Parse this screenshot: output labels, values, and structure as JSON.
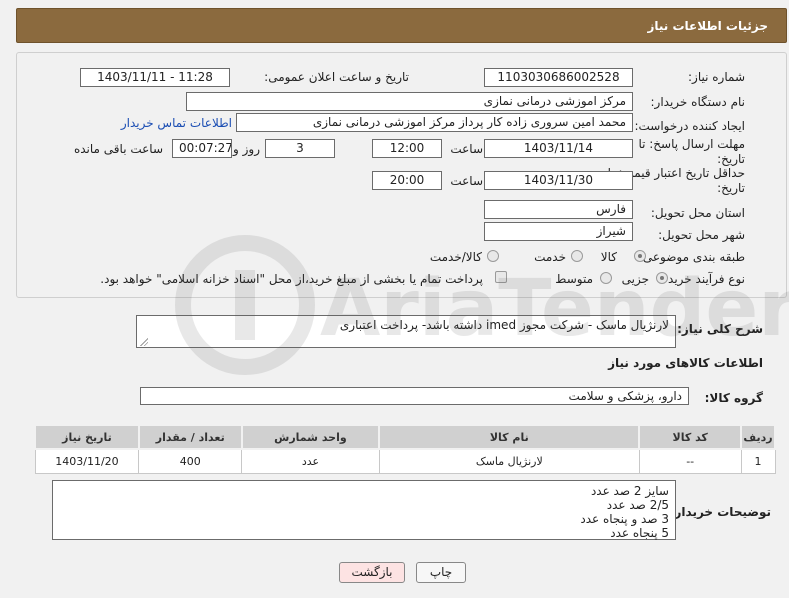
{
  "header": {
    "title": "جزئیات اطلاعات نیاز"
  },
  "form": {
    "need_number_label": "شماره نیاز:",
    "need_number": "1103030686002528",
    "announce_label": "تاریخ و ساعت اعلان عمومی:",
    "announce_value": "1403/11/11 - 11:28",
    "buyer_org_label": "نام دستگاه خریدار:",
    "buyer_org": "مرکز اموزشی درمانی نمازی",
    "creator_label": "ایجاد کننده درخواست:",
    "creator": "محمد امین سروری زاده کار پرداز مرکز اموزشی درمانی نمازی",
    "contact_link": "اطلاعات تماس خریدار",
    "deadline_label": "مهلت ارسال پاسخ: تا تاریخ:",
    "deadline_date": "1403/11/14",
    "time_label": "ساعت",
    "deadline_time": "12:00",
    "days_value": "3",
    "days_label": "روز و",
    "remaining_value": "00:07:27",
    "remaining_label": "ساعت باقی مانده",
    "validity_label": "حداقل تاریخ اعتبار قیمت: تا تاریخ:",
    "validity_date": "1403/11/30",
    "validity_time": "20:00",
    "province_label": "استان محل تحویل:",
    "province": "فارس",
    "city_label": "شهر محل تحویل:",
    "city": "شیراز",
    "category_label": "طبقه بندی موضوعی:",
    "category_options": [
      "کالا",
      "خدمت",
      "کالا/خدمت"
    ],
    "process_label": "نوع فرآیند خرید :",
    "process_options": [
      "جزیی",
      "متوسط"
    ],
    "payment_note": "پرداخت تمام یا بخشی از مبلغ خرید،از محل \"اسناد خزانه اسلامی\" خواهد بود."
  },
  "description": {
    "label": "شرح کلی نیاز:",
    "text": "لارنژیال ماسک - شرکت مجوز imed داشته باشد- پرداخت اعتباری"
  },
  "goods": {
    "section_title": "اطلاعات کالاهای مورد نیاز",
    "group_label": "گروه کالا:",
    "group_value": "دارو، پزشکی و سلامت",
    "columns": [
      "ردیف",
      "کد کالا",
      "نام کالا",
      "واحد شمارش",
      "تعداد / مقدار",
      "تاریخ نیاز"
    ],
    "rows": [
      {
        "row": "1",
        "code": "--",
        "name": "لارنژیال ماسک",
        "unit": "عدد",
        "qty": "400",
        "date": "1403/11/20"
      }
    ]
  },
  "buyer_notes": {
    "label": "توضیحات خریدار:",
    "lines": [
      "سایز 2 صد عدد",
      "2/5 صد عدد",
      "3 صد و پنجاه عدد",
      "5 پنجاه عدد"
    ]
  },
  "buttons": {
    "print": "چاپ",
    "back": "بازگشت"
  },
  "watermark": {
    "text": "AriaTender.net"
  },
  "colors": {
    "header": "#8b6a3e",
    "link": "#1a4db3",
    "back_button": "#fde3e3"
  }
}
